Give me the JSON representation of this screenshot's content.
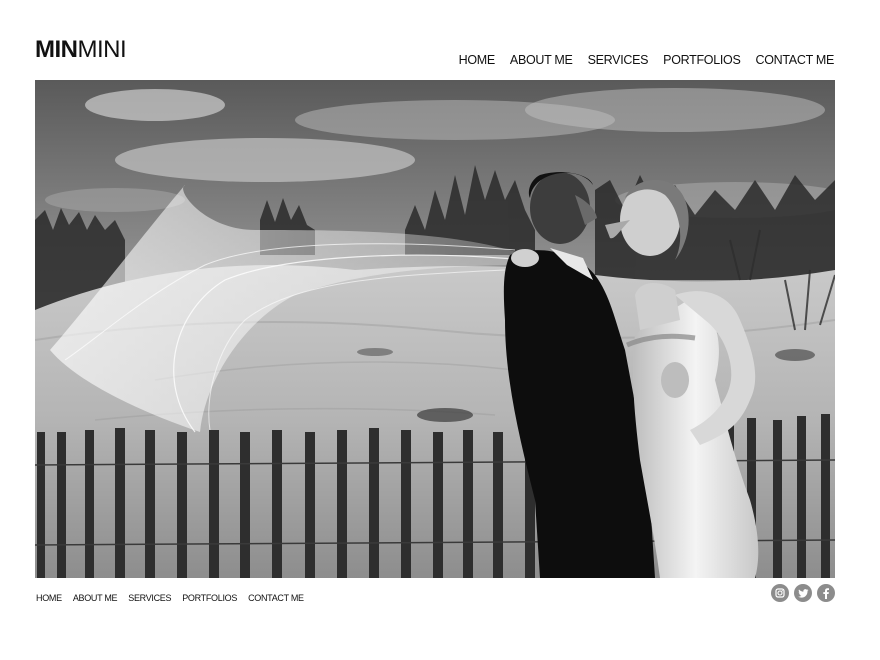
{
  "logo": {
    "bold": "MIN",
    "light": "MINI"
  },
  "main_nav": [
    {
      "label": "HOME"
    },
    {
      "label": "ABOUT ME"
    },
    {
      "label": "SERVICES"
    },
    {
      "label": "PORTFOLIOS"
    },
    {
      "label": "CONTACT ME"
    }
  ],
  "footer_nav": [
    {
      "label": "HOME"
    },
    {
      "label": "ABOUT ME"
    },
    {
      "label": "SERVICES"
    },
    {
      "label": "PORTFOLIOS"
    },
    {
      "label": "CONTACT ME"
    }
  ],
  "social": [
    {
      "icon": "instagram-icon"
    },
    {
      "icon": "twitter-icon"
    },
    {
      "icon": "facebook-icon"
    }
  ],
  "colors": {
    "text": "#111111",
    "background": "#ffffff",
    "social_icon_bg": "#8c8c8c"
  }
}
